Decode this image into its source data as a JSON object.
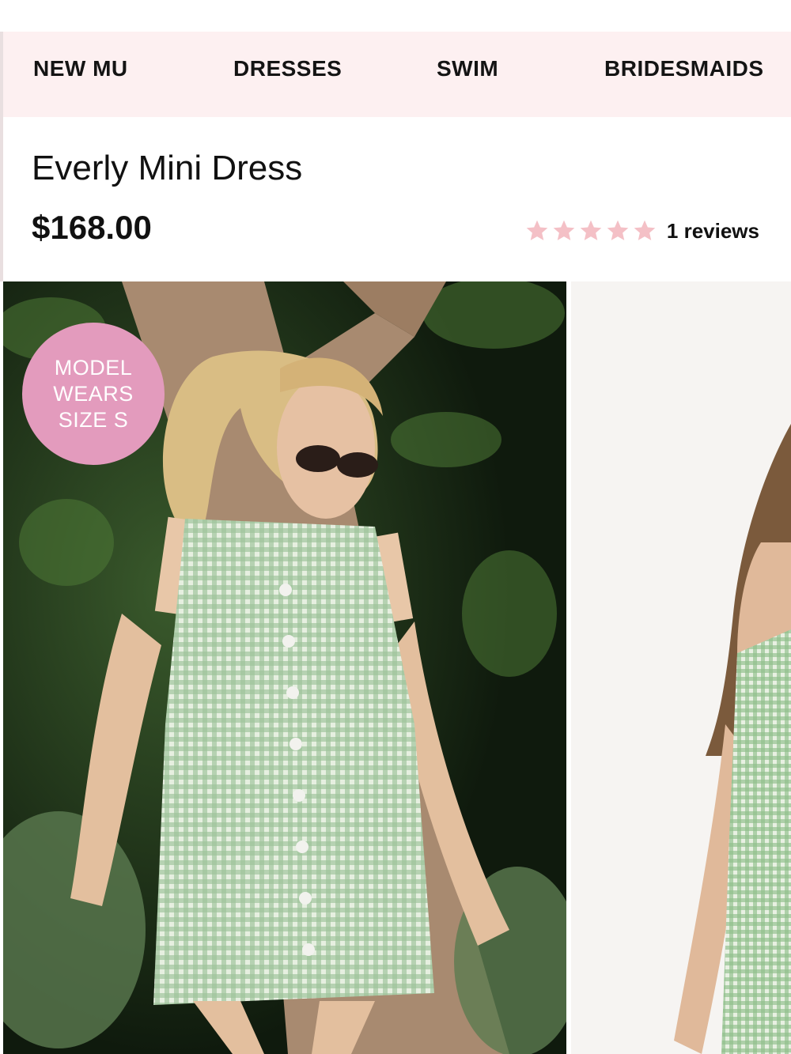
{
  "nav": {
    "items": [
      {
        "label": "NEW MU"
      },
      {
        "label": "DRESSES"
      },
      {
        "label": "SWIM"
      },
      {
        "label": "BRIDESMAIDS"
      }
    ]
  },
  "product": {
    "title": "Everly Mini Dress",
    "price": "$168.00",
    "rating": 5,
    "reviews_label": "1 reviews"
  },
  "gallery": {
    "badge": {
      "line1": "MODEL",
      "line2": "WEARS",
      "line3": "SIZE S"
    }
  },
  "colors": {
    "nav_background": "#fdf0f1",
    "star_color": "#f4c0c6",
    "badge_color": "#e39bbd",
    "dress_gingham": "#9dc39a"
  }
}
